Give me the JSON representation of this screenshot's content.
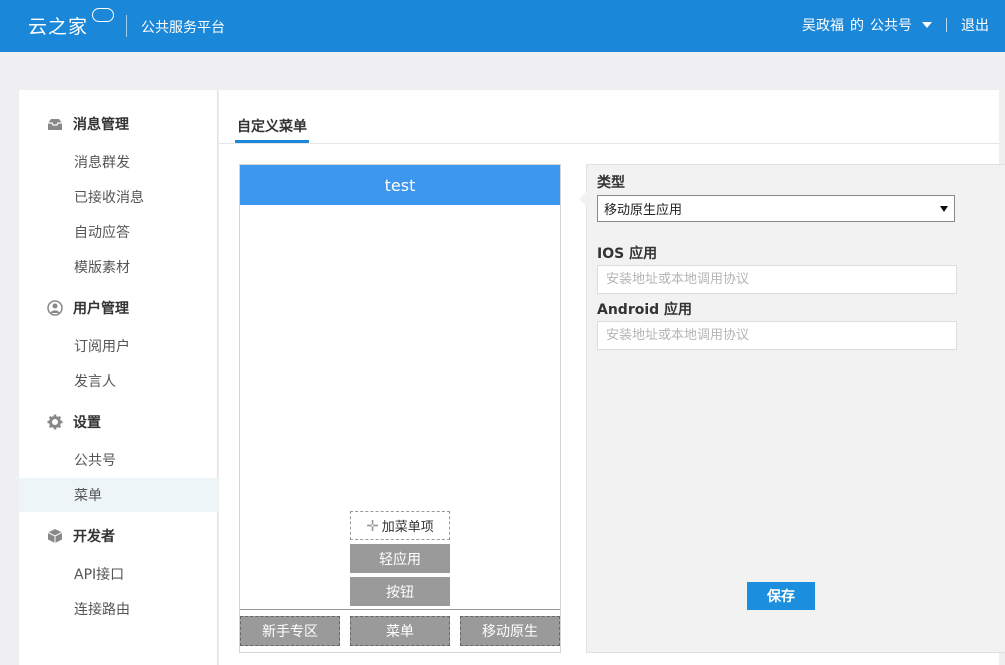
{
  "header": {
    "logo_text": "云之家",
    "platform": "公共服务平台",
    "user_name": "吴政福",
    "user_suffix": "的",
    "account_type": "公共号",
    "logout": "退出"
  },
  "sidebar": {
    "groups": [
      {
        "title": "消息管理",
        "icon": "inbox-icon",
        "items": [
          "消息群发",
          "已接收消息",
          "自动应答",
          "模版素材"
        ]
      },
      {
        "title": "用户管理",
        "icon": "user-icon",
        "items": [
          "订阅用户",
          "发言人"
        ]
      },
      {
        "title": "设置",
        "icon": "gear-icon",
        "items": [
          "公共号",
          "菜单"
        ]
      },
      {
        "title": "开发者",
        "icon": "cube-icon",
        "items": [
          "API接口",
          "连接路由"
        ]
      }
    ],
    "active_item": "菜单"
  },
  "main": {
    "tab": "自定义菜单",
    "phone": {
      "title": "test",
      "add_item": "加菜单项",
      "sub_buttons": [
        "轻应用",
        "按钮"
      ],
      "menu_buttons": [
        "新手专区",
        "菜单",
        "移动原生"
      ]
    },
    "panel": {
      "type_label": "类型",
      "type_value": "移动原生应用",
      "ios_label": "IOS 应用",
      "ios_placeholder": "安装地址或本地调用协议",
      "android_label": "Android 应用",
      "android_placeholder": "安装地址或本地调用协议",
      "save": "保存"
    }
  },
  "colors": {
    "header": "#1b87d8",
    "phone_header": "#3d97ee",
    "menu_button": "#9a9a9a",
    "save": "#1b8fde"
  }
}
